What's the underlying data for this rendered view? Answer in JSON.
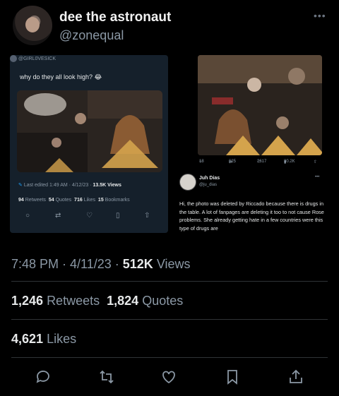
{
  "author": {
    "display_name": "dee the astronaut",
    "handle": "@zonequal"
  },
  "embedded_left": {
    "handle": "@GIRL0VESICK",
    "text": "why do they all look high? 😂",
    "edited": "Last edited 1:49 AM · 4/12/23 ·",
    "views": "13.5K Views",
    "retweets_num": "94",
    "retweets_label": "Retweets",
    "quotes_num": "54",
    "quotes_label": "Quotes",
    "likes_num": "716",
    "likes_label": "Likes",
    "bookmarks_num": "15",
    "bookmarks_label": "Bookmarks"
  },
  "embedded_right": {
    "stats": {
      "replies": "18",
      "retweets": "625",
      "likes": "2617",
      "views": "80.2K"
    },
    "reply_name": "Juh Dias",
    "reply_handle": "@ju_dias",
    "reply_text": "Hi, the photo was deleted by Riccado because there is drugs in the table. A lot of fanpages are deleting it too to not cause Rose problems. She already getting hate in a few countries were this type of drugs are"
  },
  "tweet": {
    "time": "7:48 PM · 4/11/23 ·",
    "views_num": "512K",
    "views_label": "Views",
    "retweets_num": "1,246",
    "retweets_label": "Retweets",
    "quotes_num": "1,824",
    "quotes_label": "Quotes",
    "likes_num": "4,621",
    "likes_label": "Likes"
  },
  "icons": [
    "reply-icon",
    "retweet-icon",
    "like-icon",
    "bookmark-icon",
    "share-icon"
  ],
  "colors": {
    "background": "#000000",
    "card": "#15202b",
    "muted": "#8b98a5",
    "text": "#e7e9ea"
  }
}
